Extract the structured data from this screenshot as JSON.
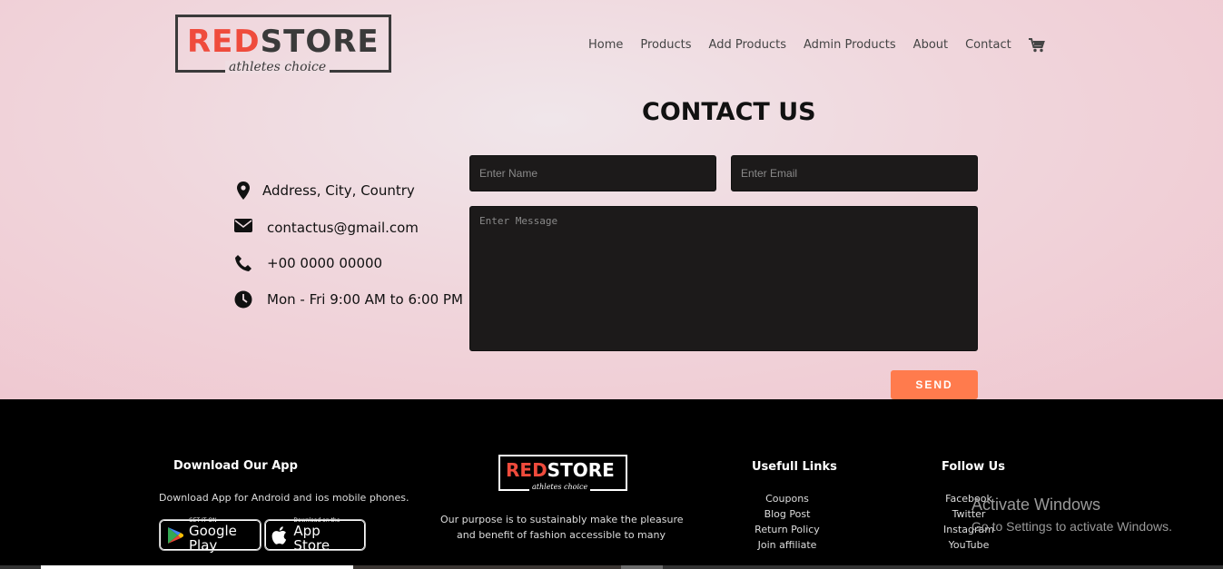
{
  "logo": {
    "red_part": "RED",
    "dark_part": "STORE",
    "tagline": "athletes choice"
  },
  "nav": {
    "items": [
      "Home",
      "Products",
      "Add Products",
      "Admin Products",
      "About",
      "Contact"
    ],
    "cart_icon": "cart-icon"
  },
  "page_title": "CONTACT US",
  "contact_info": {
    "address": "Address, City, Country",
    "email": "contactus@gmail.com",
    "phone": "+00 0000 00000",
    "hours": "Mon - Fri 9:00 AM to 6:00 PM"
  },
  "form": {
    "name_placeholder": "Enter Name",
    "email_placeholder": "Enter Email",
    "message_placeholder": "Enter Message",
    "send_label": "SEND"
  },
  "footer": {
    "app": {
      "heading": "Download Our App",
      "text": "Download App for Android and ios mobile phones.",
      "google_small": "GET IT ON",
      "google_big": "Google Play",
      "apple_small": "Download on the",
      "apple_big": "App Store"
    },
    "about": {
      "line1": "Our purpose is to sustainably make the pleasure",
      "line2": "and benefit of fashion accessible to many"
    },
    "useful_links": {
      "heading": "Usefull Links",
      "items": [
        "Coupons",
        "Blog Post",
        "Return Policy",
        "Join affiliate"
      ]
    },
    "follow": {
      "heading": "Follow Us",
      "items": [
        "Facebook",
        "Twitter",
        "Instagram",
        "YouTube"
      ]
    }
  },
  "watermark": {
    "line1": "Activate Windows",
    "line2": "Go to Settings to activate Windows."
  },
  "colors": {
    "accent": "#ff7b4d",
    "brand_red": "#ef4b3c",
    "field_bg": "#1c1a1a"
  }
}
